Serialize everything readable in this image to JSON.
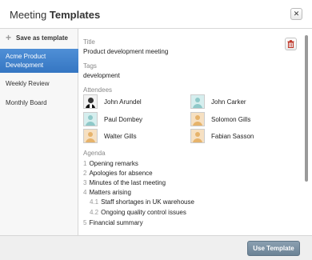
{
  "dialog": {
    "title_prefix": "Meeting",
    "title_bold": "Templates",
    "close_glyph": "✕"
  },
  "sidebar": {
    "save_label": "Save as template",
    "items": [
      {
        "label": "Acme Product Development",
        "active": true
      },
      {
        "label": "Weekly Review",
        "active": false
      },
      {
        "label": "Monthly Board",
        "active": false
      }
    ]
  },
  "template": {
    "title_label": "Title",
    "title_value": "Product development meeting",
    "tags_label": "Tags",
    "tags_value": "development",
    "attendees_label": "Attendees",
    "attendees": [
      {
        "name": "John Arundel",
        "avatar": "photo"
      },
      {
        "name": "John Carker",
        "avatar": "teal"
      },
      {
        "name": "Paul Dombey",
        "avatar": "teal"
      },
      {
        "name": "Solomon Gills",
        "avatar": "orange"
      },
      {
        "name": "Walter Gills",
        "avatar": "orange"
      },
      {
        "name": "Fabian Sasson",
        "avatar": "orange"
      }
    ],
    "agenda_label": "Agenda",
    "agenda": [
      {
        "num": "1",
        "text": "Opening remarks"
      },
      {
        "num": "2",
        "text": "Apologies for absence"
      },
      {
        "num": "3",
        "text": "Minutes of the last meeting"
      },
      {
        "num": "4",
        "text": "Matters arising"
      },
      {
        "num": "4.1",
        "text": "Staff shortages in UK warehouse"
      },
      {
        "num": "4.2",
        "text": "Ongoing quality control issues"
      },
      {
        "num": "5",
        "text": "Financial summary"
      }
    ]
  },
  "footer": {
    "use_label": "Use Template"
  },
  "colors": {
    "accent": "#3a7cc6",
    "button": "#7a90a3",
    "delete_icon": "#c0392b"
  },
  "icons": {
    "close": "close-icon",
    "save": "plus-icon",
    "delete": "trash-icon"
  }
}
